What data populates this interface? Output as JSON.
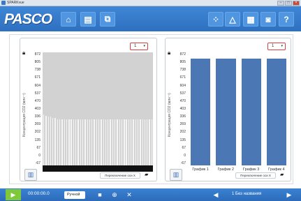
{
  "window": {
    "title": "SPARKvue",
    "controls": [
      "–",
      "□",
      "×"
    ]
  },
  "toolbar": {
    "logo": "PASCO",
    "left_buttons": [
      {
        "icon": "home-icon",
        "glyph": "⌂"
      },
      {
        "icon": "document-icon",
        "glyph": "▤"
      },
      {
        "icon": "export-icon",
        "glyph": "⧉"
      }
    ],
    "right_buttons": [
      {
        "icon": "sensor-icon",
        "glyph": "⁘"
      },
      {
        "icon": "analysis-icon",
        "glyph": "△"
      },
      {
        "icon": "journal-icon",
        "glyph": "▦"
      },
      {
        "icon": "camera-icon",
        "glyph": "◙"
      },
      {
        "icon": "help-icon",
        "glyph": "?"
      }
    ]
  },
  "left_panel": {
    "run_number": "1",
    "y_axis_title": "Концентрация СО2 (млн⁻¹)",
    "y_ticks": [
      "872",
      "805",
      "738",
      "671",
      "604",
      "537",
      "470",
      "403",
      "336",
      "269",
      "202",
      "135",
      "67",
      "0",
      "-67"
    ],
    "bar_count": 48,
    "bar_levels_fraction": [
      0.45,
      0.44,
      0.43,
      0.43,
      0.42,
      0.42,
      0.41,
      0.41,
      0.41,
      0.41,
      0.41,
      0.41,
      0.41,
      0.41,
      0.41,
      0.41,
      0.41,
      0.41,
      0.41,
      0.41,
      0.41,
      0.41,
      0.41,
      0.41,
      0.41,
      0.41,
      0.41,
      0.41,
      0.41,
      0.41,
      0.41,
      0.41,
      0.41,
      0.41,
      0.41,
      0.41,
      0.41,
      0.41,
      0.41,
      0.41,
      0.41,
      0.41,
      0.41,
      0.41,
      0.41,
      0.41,
      0.41,
      0.41
    ],
    "pager_label": "Переключение оси Х"
  },
  "right_panel": {
    "run_number": "1",
    "y_axis_title": "Концентрация СО2 (млн⁻¹)",
    "y_ticks": [
      "872",
      "805",
      "738",
      "671",
      "604",
      "537",
      "470",
      "403",
      "336",
      "269",
      "202",
      "135",
      "67",
      "0",
      "-67"
    ],
    "categories": [
      "График 1",
      "График 2",
      "График 3",
      "График 4"
    ],
    "bar_fill_fraction": [
      0.97,
      0.97,
      0.97,
      0.97
    ],
    "pager_label": "Переключение оси Х"
  },
  "bottom_bar": {
    "time": "00:00:00.0",
    "mode": "Ручной",
    "dataset": "1 Без названия"
  },
  "colors": {
    "toolbar_blue": "#2f70c0",
    "bar_blue": "#4b77b5",
    "play_green": "#7ec83a",
    "highlight_red": "#d94040"
  }
}
